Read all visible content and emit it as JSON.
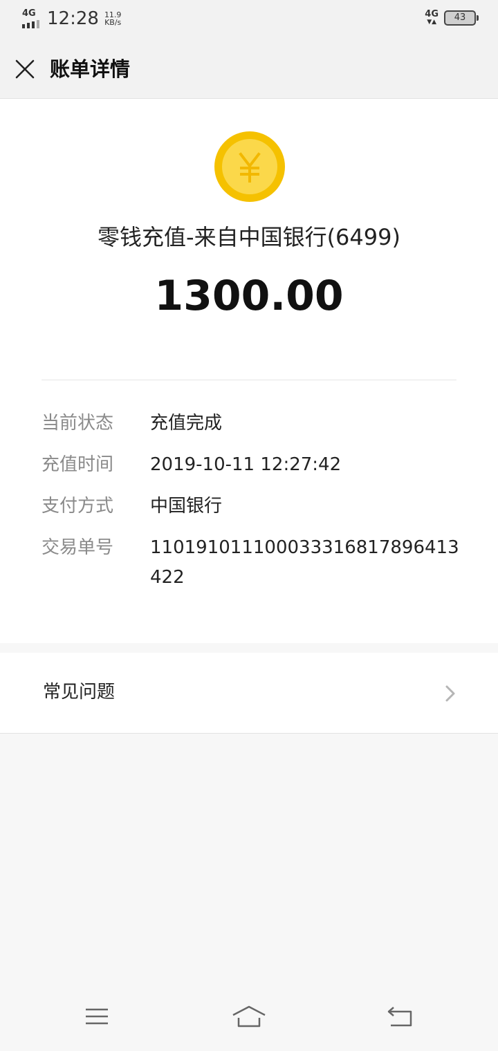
{
  "status_bar": {
    "network_left": "4G",
    "time": "12:28",
    "speed_value": "11.9",
    "speed_unit": "KB/s",
    "network_right": "4G",
    "battery": "43"
  },
  "header": {
    "close_icon": "close-icon",
    "title": "账单详情"
  },
  "transaction": {
    "icon": "yuan-coin-icon",
    "icon_colors": {
      "outer": "#f5c100",
      "inner": "#fbd84a",
      "glyph": "#f2b800"
    },
    "title": "零钱充值-来自中国银行(6499)",
    "amount": "1300.00"
  },
  "details": [
    {
      "label": "当前状态",
      "value": "充值完成"
    },
    {
      "label": "充值时间",
      "value": "2019-10-11 12:27:42"
    },
    {
      "label": "支付方式",
      "value": "中国银行"
    },
    {
      "label": "交易单号",
      "value": "110191011100033316817896413422"
    }
  ],
  "faq": {
    "label": "常见问题",
    "icon": "chevron-right-icon"
  },
  "system_nav": {
    "menu_icon": "menu-icon",
    "home_icon": "home-icon",
    "back_icon": "back-icon"
  }
}
